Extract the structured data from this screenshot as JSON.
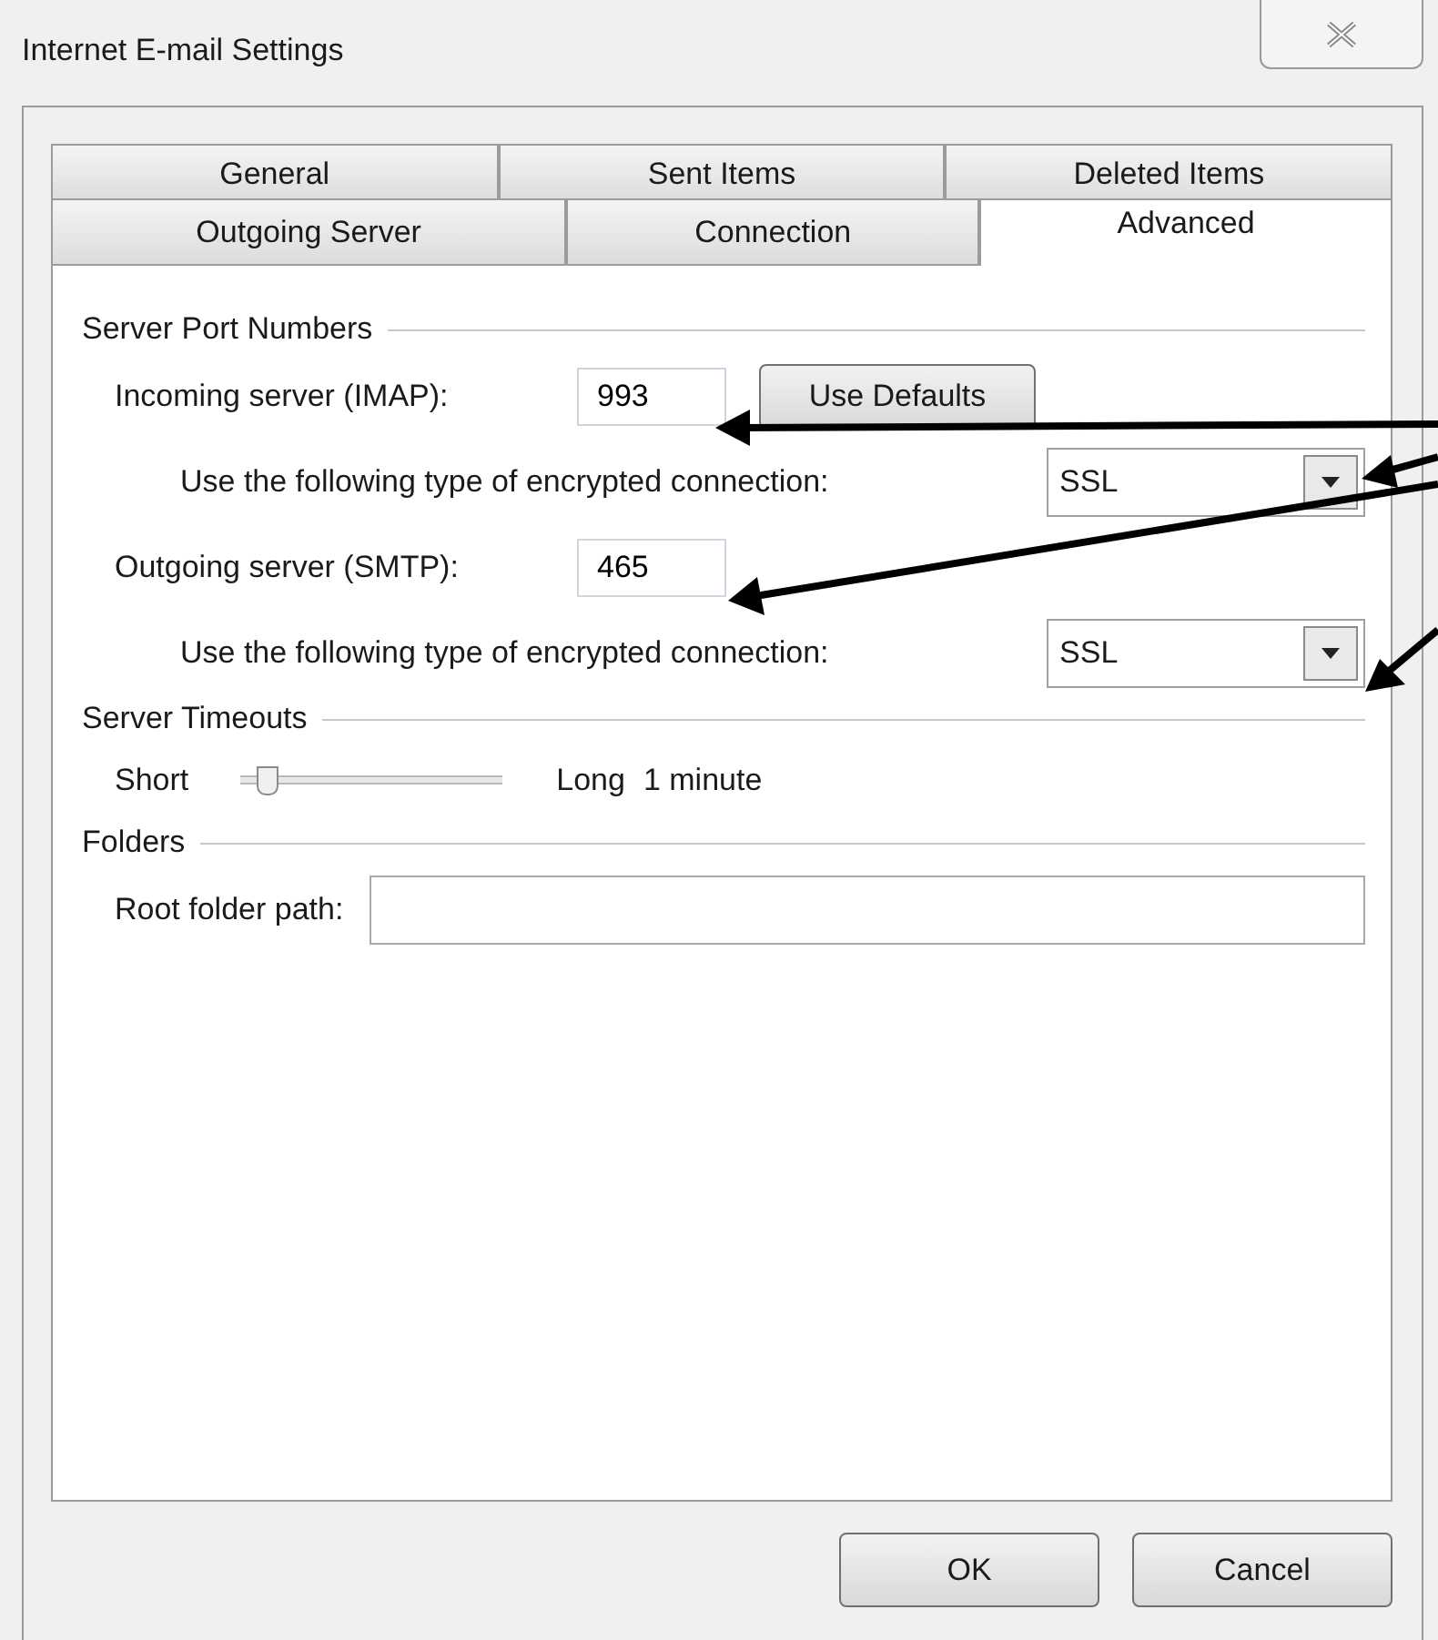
{
  "window": {
    "title": "Internet E-mail Settings"
  },
  "tab_rows": [
    [
      {
        "label": "General",
        "selected": false
      },
      {
        "label": "Sent Items",
        "selected": false
      },
      {
        "label": "Deleted Items",
        "selected": false
      }
    ],
    [
      {
        "label": "Outgoing Server",
        "selected": false
      },
      {
        "label": "Connection",
        "selected": false
      },
      {
        "label": "Advanced",
        "selected": true
      }
    ]
  ],
  "port_section": {
    "title": "Server Port Numbers",
    "incoming": {
      "label": "Incoming server (IMAP):",
      "value": "993",
      "button": "Use Defaults"
    },
    "incoming_encryption": {
      "label": "Use the following type of encrypted connection:",
      "value": "SSL"
    },
    "outgoing": {
      "label": "Outgoing server (SMTP):",
      "value": "465"
    },
    "outgoing_encryption": {
      "label": "Use the following type of encrypted connection:",
      "value": "SSL"
    }
  },
  "timeout_section": {
    "title": "Server Timeouts",
    "min_label": "Short",
    "max_label": "Long",
    "level": 0.1,
    "reading": "1 minute"
  },
  "folders_section": {
    "title": "Folders",
    "root_label": "Root folder path:"
  },
  "buttons": [
    "OK",
    "Cancel"
  ]
}
